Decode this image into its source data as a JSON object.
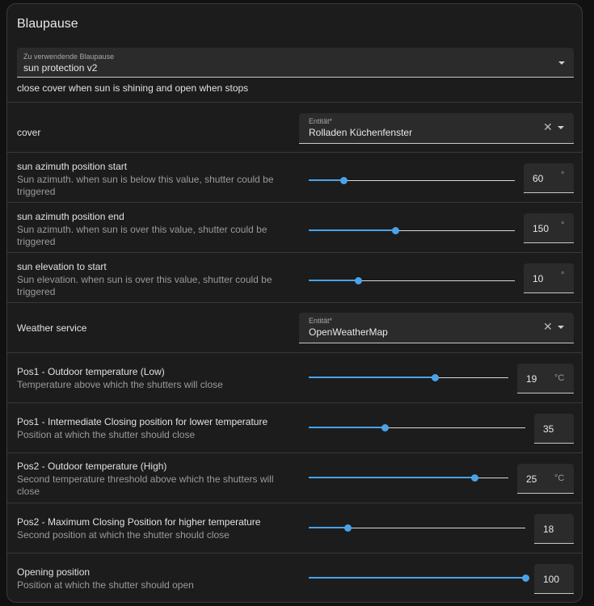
{
  "title": "Blaupause",
  "blueprint": {
    "label": "Zu verwendende Blaupause",
    "value": "sun protection v2",
    "description": "close cover when sun is shining and open when stops"
  },
  "cover": {
    "label": "cover",
    "entity_label": "Entität*",
    "entity_value": "Rolladen Küchenfenster"
  },
  "azimuth_start": {
    "label": "sun azimuth position start",
    "desc": "Sun azimuth. when sun is below this value, shutter could be triggered",
    "value": "60",
    "unit": "°",
    "level": 0.17
  },
  "azimuth_end": {
    "label": "sun azimuth position end",
    "desc": "Sun azimuth. when sun is over this value, shutter could be triggered",
    "value": "150",
    "unit": "°",
    "level": 0.42
  },
  "elevation_start": {
    "label": "sun elevation to start",
    "desc": "Sun elevation. when sun is over this value, shutter could be triggered",
    "value": "10",
    "unit": "°",
    "level": 0.24
  },
  "weather": {
    "label": "Weather service",
    "entity_label": "Entität*",
    "entity_value": "OpenWeatherMap"
  },
  "pos1_temp": {
    "label": "Pos1 - Outdoor temperature (Low)",
    "desc": "Temperature above which the shutters will close",
    "value": "19",
    "unit": "°C",
    "level": 0.63
  },
  "pos1_close": {
    "label": "Pos1 - Intermediate Closing position for lower temperature",
    "desc": "Position at which the shutter should close",
    "value": "35",
    "level": 0.35
  },
  "pos2_temp": {
    "label": "Pos2 - Outdoor temperature (High)",
    "desc": "Second temperature threshold above which the shutters will close",
    "value": "25",
    "unit": "°C",
    "level": 0.83
  },
  "pos2_close": {
    "label": "Pos2 - Maximum Closing Position for higher temperature",
    "desc": "Second position at which the shutter should close",
    "value": "18",
    "level": 0.18
  },
  "opening": {
    "label": "Opening position",
    "desc": "Position at which the shutter should open",
    "value": "100",
    "level": 1.0
  },
  "colors": {
    "accent": "#4aa3e8",
    "card": "#1c1c1c",
    "field": "#2b2b2b"
  },
  "icons": {
    "clear": "close-icon",
    "dropdown": "arrow-drop-down-icon"
  }
}
